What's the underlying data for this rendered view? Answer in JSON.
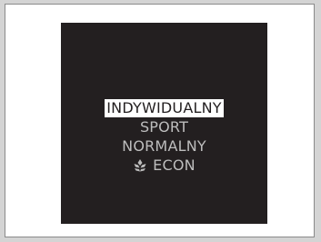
{
  "display": {
    "modes": [
      {
        "label": "INDYWIDUALNY",
        "selected": true
      },
      {
        "label": "SPORT",
        "selected": false
      },
      {
        "label": "NORMALNY",
        "selected": false
      },
      {
        "label": "ECON",
        "selected": false,
        "icon": "leaf-icon"
      }
    ]
  }
}
